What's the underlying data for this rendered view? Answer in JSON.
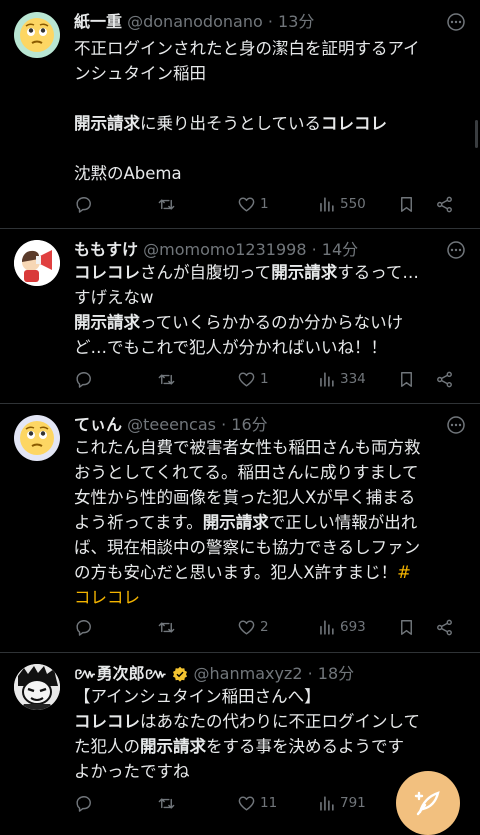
{
  "colors": {
    "background": "#000000",
    "text": "#e7e9ea",
    "muted": "#71767b",
    "divider": "#2f3336",
    "hashtag": "#f4b400",
    "fab": "#f2c07f"
  },
  "tweets": [
    {
      "name": "紙一重",
      "handle": "@donanodonano",
      "dot": "·",
      "time": "13分",
      "avatar_icon": "worried-face-emoji-avatar",
      "lines": [
        [
          {
            "t": "不正ログインされたと身の潔白を証明するアイ",
            "s": ""
          }
        ],
        [
          {
            "t": "ンシュタイン稲田",
            "s": ""
          }
        ],
        [
          {
            "t": "",
            "s": ""
          }
        ],
        [
          {
            "t": "開示請求",
            "s": "b"
          },
          {
            "t": "に乗り出そうとしている",
            "s": ""
          },
          {
            "t": "コレコレ",
            "s": "b"
          }
        ],
        [
          {
            "t": "",
            "s": ""
          }
        ],
        [
          {
            "t": "沈黙のAbema",
            "s": ""
          }
        ]
      ],
      "likes": "1",
      "views": "550"
    },
    {
      "name": "ももすけ",
      "handle": "@momomo1231998",
      "dot": "·",
      "time": "14分",
      "avatar_icon": "megaphone-girl-avatar",
      "lines": [
        [
          {
            "t": "コレコレ",
            "s": "b"
          },
          {
            "t": "さんが自腹切って",
            "s": ""
          },
          {
            "t": "開示請求",
            "s": "b"
          },
          {
            "t": "するって…",
            "s": ""
          }
        ],
        [
          {
            "t": "すげえなw",
            "s": ""
          }
        ],
        [
          {
            "t": "開示請求",
            "s": "b"
          },
          {
            "t": "っていくらかかるのか分からないけ",
            "s": ""
          }
        ],
        [
          {
            "t": "ど…でもこれで犯人が分かればいいね！！",
            "s": ""
          }
        ]
      ],
      "likes": "1",
      "views": "334"
    },
    {
      "name": "てぃん",
      "handle": "@teeencas",
      "dot": "·",
      "time": "16分",
      "avatar_icon": "worried-face-emoji-avatar",
      "lines": [
        [
          {
            "t": "これたん自費で被害者女性も稲田さんも両方救",
            "s": ""
          }
        ],
        [
          {
            "t": "おうとしてくれてる。稲田さんに成りすまして",
            "s": ""
          }
        ],
        [
          {
            "t": "女性から性的画像を貰った犯人Xが早く捕まる",
            "s": ""
          }
        ],
        [
          {
            "t": "よう祈ってます。",
            "s": ""
          },
          {
            "t": "開示請求",
            "s": "b"
          },
          {
            "t": "で正しい情報が出れ",
            "s": ""
          }
        ],
        [
          {
            "t": "ば、現在相談中の警察にも協力できるしファン",
            "s": ""
          }
        ],
        [
          {
            "t": "の方も安心だと思います。犯人X許すまじ！",
            "s": ""
          },
          {
            "t": "#",
            "s": "h"
          }
        ],
        [
          {
            "t": "コレコレ",
            "s": "h"
          }
        ]
      ],
      "likes": "2",
      "views": "693"
    },
    {
      "name": "៚勇次郎៚",
      "handle": "@hanmaxyz2",
      "dot": "·",
      "time": "18分",
      "avatar_icon": "manga-character-avatar",
      "lines": [
        [
          {
            "t": "【アインシュタイン稲田さんへ】",
            "s": ""
          }
        ],
        [
          {
            "t": "コレコレ",
            "s": "b"
          },
          {
            "t": "はあなたの代わりに不正ログインして",
            "s": ""
          }
        ],
        [
          {
            "t": "た犯人の",
            "s": ""
          },
          {
            "t": "開示請求",
            "s": "b"
          },
          {
            "t": "をする事を決めるようです",
            "s": ""
          }
        ],
        [
          {
            "t": "よかったですね",
            "s": ""
          }
        ]
      ],
      "likes": "11",
      "views": "791"
    }
  ]
}
